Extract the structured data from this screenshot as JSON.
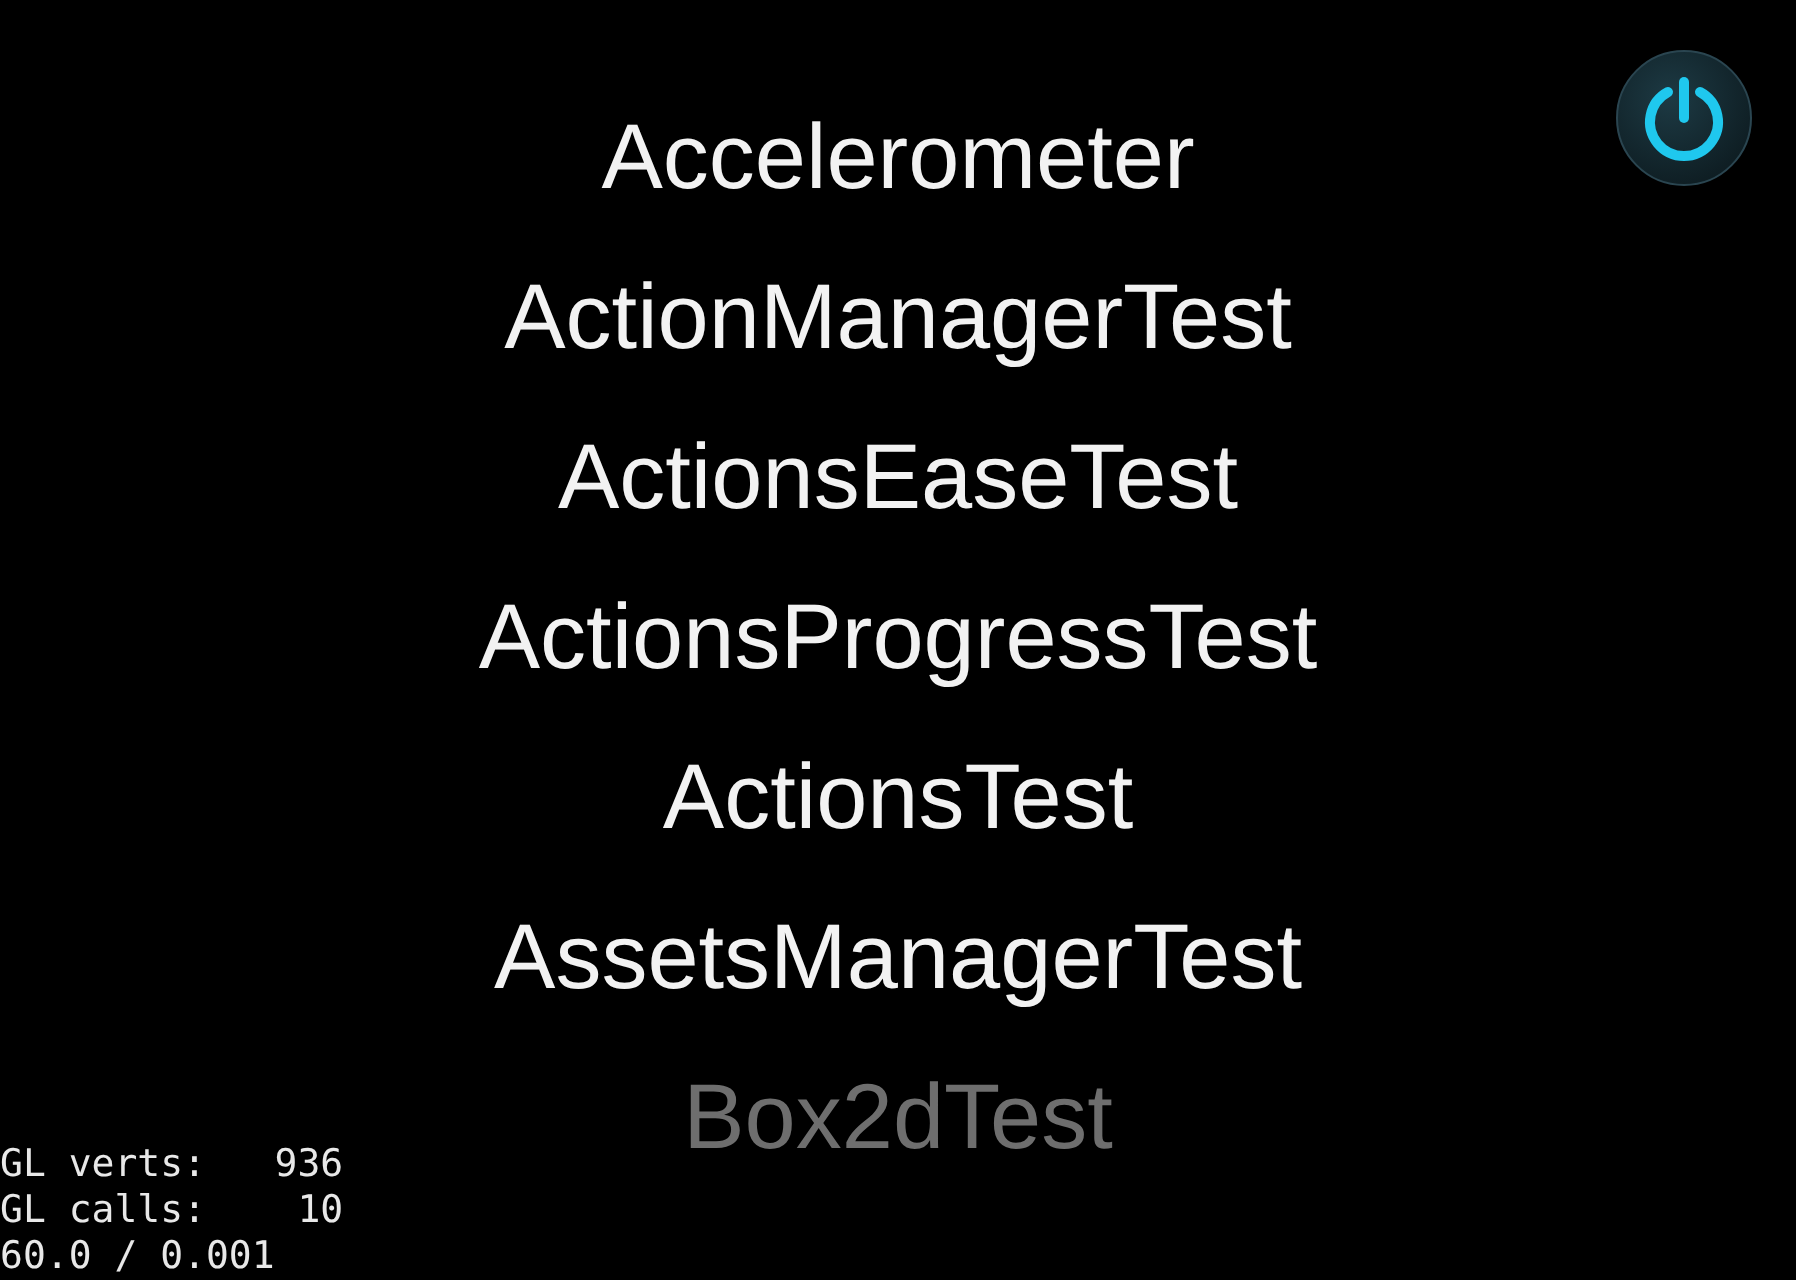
{
  "menu_items": [
    {
      "label": "Accelerometer",
      "disabled": false
    },
    {
      "label": "ActionManagerTest",
      "disabled": false
    },
    {
      "label": "ActionsEaseTest",
      "disabled": false
    },
    {
      "label": "ActionsProgressTest",
      "disabled": false
    },
    {
      "label": "ActionsTest",
      "disabled": false
    },
    {
      "label": "AssetsManagerTest",
      "disabled": false
    },
    {
      "label": "Box2dTest",
      "disabled": true
    }
  ],
  "stats": [
    "GL verts:   936",
    "GL calls:    10",
    "60.0 / 0.001"
  ]
}
